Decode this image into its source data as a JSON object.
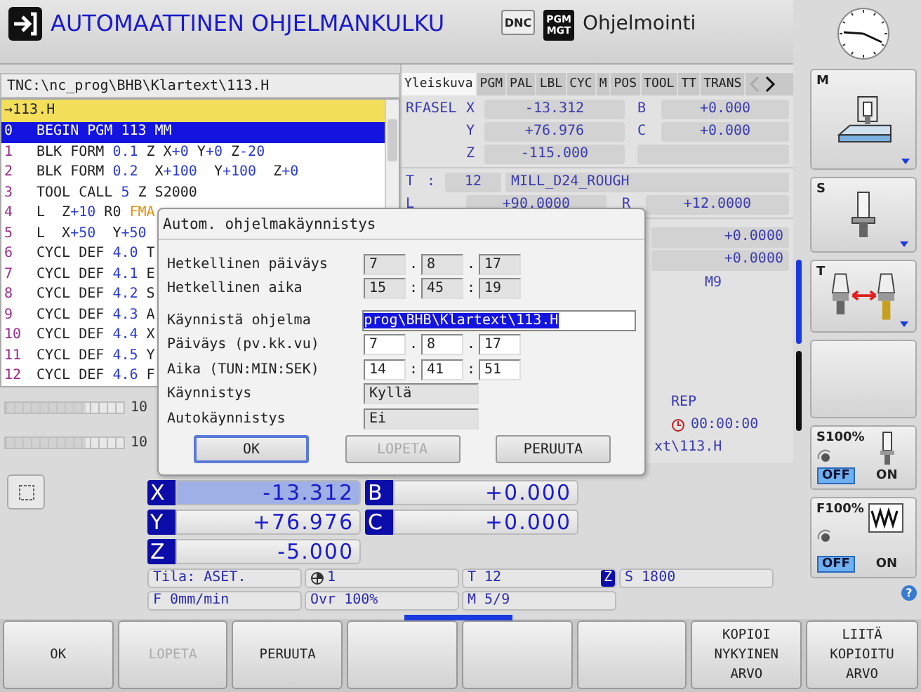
{
  "header": {
    "title": "AUTOMAATTINEN OHJELMANKULKU",
    "badges": [
      {
        "text": "DNC",
        "kind": "light"
      },
      {
        "text": "PGM MGT",
        "kind": "dark"
      }
    ],
    "mode": "Ohjelmointi"
  },
  "program": {
    "path": "TNC:\\nc_prog\\BHB\\Klartext\\113.H",
    "file_arrow": "→",
    "file": "113.H",
    "lines": [
      {
        "number": "0",
        "selected": true,
        "segments": [
          {
            "text": "BEGIN PGM 113 MM",
            "kind": "kw"
          }
        ]
      },
      {
        "number": "1",
        "selected": false,
        "segments": [
          {
            "text": "BLK FORM ",
            "kind": "kw"
          },
          {
            "text": "0.1",
            "kind": "num"
          },
          {
            "text": " Z X",
            "kind": "kw"
          },
          {
            "text": "+0",
            "kind": "num"
          },
          {
            "text": " Y",
            "kind": "kw"
          },
          {
            "text": "+0",
            "kind": "num"
          },
          {
            "text": " Z",
            "kind": "kw"
          },
          {
            "text": "-20",
            "kind": "num"
          }
        ]
      },
      {
        "number": "2",
        "selected": false,
        "segments": [
          {
            "text": "BLK FORM ",
            "kind": "kw"
          },
          {
            "text": "0.2",
            "kind": "num"
          },
          {
            "text": "  X",
            "kind": "kw"
          },
          {
            "text": "+100",
            "kind": "num"
          },
          {
            "text": "  Y",
            "kind": "kw"
          },
          {
            "text": "+100",
            "kind": "num"
          },
          {
            "text": "  Z",
            "kind": "kw"
          },
          {
            "text": "+0",
            "kind": "num"
          }
        ]
      },
      {
        "number": "3",
        "selected": false,
        "segments": [
          {
            "text": "TOOL CALL ",
            "kind": "kw"
          },
          {
            "text": "5",
            "kind": "num"
          },
          {
            "text": " Z S2000",
            "kind": "kw"
          }
        ]
      },
      {
        "number": "4",
        "selected": false,
        "segments": [
          {
            "text": "L  Z",
            "kind": "kw"
          },
          {
            "text": "+10",
            "kind": "num"
          },
          {
            "text": " R0 ",
            "kind": "kw"
          },
          {
            "text": "FMA",
            "kind": "fmax"
          }
        ]
      },
      {
        "number": "5",
        "selected": false,
        "segments": [
          {
            "text": "L  X",
            "kind": "kw"
          },
          {
            "text": "+50",
            "kind": "num"
          },
          {
            "text": "  Y",
            "kind": "kw"
          },
          {
            "text": "+50",
            "kind": "num"
          }
        ]
      },
      {
        "number": "6",
        "selected": false,
        "segments": [
          {
            "text": "CYCL DEF ",
            "kind": "kw"
          },
          {
            "text": "4.0",
            "kind": "num"
          },
          {
            "text": " T",
            "kind": "kw"
          }
        ]
      },
      {
        "number": "7",
        "selected": false,
        "segments": [
          {
            "text": "CYCL DEF ",
            "kind": "kw"
          },
          {
            "text": "4.1",
            "kind": "num"
          },
          {
            "text": " E",
            "kind": "kw"
          }
        ]
      },
      {
        "number": "8",
        "selected": false,
        "segments": [
          {
            "text": "CYCL DEF ",
            "kind": "kw"
          },
          {
            "text": "4.2",
            "kind": "num"
          },
          {
            "text": " S",
            "kind": "kw"
          }
        ]
      },
      {
        "number": "9",
        "selected": false,
        "segments": [
          {
            "text": "CYCL DEF ",
            "kind": "kw"
          },
          {
            "text": "4.3",
            "kind": "num"
          },
          {
            "text": " A",
            "kind": "kw"
          }
        ]
      },
      {
        "number": "10",
        "selected": false,
        "segments": [
          {
            "text": "CYCL DEF ",
            "kind": "kw"
          },
          {
            "text": "4.4",
            "kind": "num"
          },
          {
            "text": " X",
            "kind": "kw"
          }
        ]
      },
      {
        "number": "11",
        "selected": false,
        "segments": [
          {
            "text": "CYCL DEF ",
            "kind": "kw"
          },
          {
            "text": "4.5",
            "kind": "num"
          },
          {
            "text": " Y",
            "kind": "kw"
          }
        ]
      },
      {
        "number": "12",
        "selected": false,
        "segments": [
          {
            "text": "CYCL DEF ",
            "kind": "kw"
          },
          {
            "text": "4.6",
            "kind": "num"
          },
          {
            "text": " F",
            "kind": "kw"
          }
        ]
      }
    ]
  },
  "overrides": [
    {
      "level": 0.68,
      "label": "10"
    },
    {
      "level": 0.68,
      "label": "10"
    }
  ],
  "panel": {
    "tabs": [
      {
        "label": "Yleiskuva",
        "selected": true
      },
      {
        "label": "PGM",
        "selected": false
      },
      {
        "label": "PAL",
        "selected": false
      },
      {
        "label": "LBL",
        "selected": false
      },
      {
        "label": "CYC",
        "selected": false
      },
      {
        "label": "M",
        "selected": false
      },
      {
        "label": "POS",
        "selected": false
      },
      {
        "label": "TOOL",
        "selected": false
      },
      {
        "label": "TT",
        "selected": false
      },
      {
        "label": "TRANS",
        "selected": false
      }
    ],
    "tab_arrows": [
      {
        "kind": "left",
        "disabled": true
      },
      {
        "kind": "right",
        "disabled": false
      }
    ],
    "label": "RFASEL",
    "axes": [
      {
        "axis": "X",
        "value": "-13.312"
      },
      {
        "axis": "Y",
        "value": "+76.976"
      },
      {
        "axis": "Z",
        "value": "-115.000"
      }
    ],
    "rot_axes": [
      {
        "axis": "B",
        "value": "+0.000"
      },
      {
        "axis": "C",
        "value": "+0.000"
      }
    ],
    "tool": {
      "label": "T",
      "separator": ":",
      "number": "12",
      "name": "MILL_D24_ROUGH"
    },
    "dims": [
      {
        "label": "L",
        "value": "+90.0000"
      },
      {
        "label": "R",
        "value": "+12.0000"
      }
    ],
    "more": [
      {
        "kind": "value",
        "text": "+0.0000"
      },
      {
        "kind": "value",
        "text": "+0.0000"
      },
      {
        "kind": "text",
        "text": "M9"
      },
      {
        "kind": "status",
        "text": "REP"
      },
      {
        "kind": "timer",
        "text": "00:00:00"
      },
      {
        "kind": "path",
        "text": "xt\\113.H"
      }
    ]
  },
  "positions": [
    {
      "axis": "X",
      "value": "-13.312",
      "selected": true
    },
    {
      "axis": "B",
      "value": "+0.000",
      "selected": false
    },
    {
      "axis": "Y",
      "value": "+76.976",
      "selected": false
    },
    {
      "axis": "C",
      "value": "+0.000",
      "selected": false
    },
    {
      "axis": "Z",
      "value": "-5.000",
      "selected": false
    }
  ],
  "status": [
    {
      "kind": "text",
      "text": "Tila: ASET."
    },
    {
      "kind": "datum",
      "text": "1"
    },
    {
      "kind": "tool",
      "text": "T 12",
      "axis": "Z"
    },
    {
      "kind": "text",
      "text": "S 1800"
    },
    {
      "kind": "text",
      "text": "F 0mm/min"
    },
    {
      "kind": "text",
      "text": "Ovr 100%"
    },
    {
      "kind": "text",
      "text": "M 5/9"
    }
  ],
  "dialog": {
    "title": "Autom. ohjelmakäynnistys",
    "rows": [
      {
        "label": "Hetkellinen päiväys",
        "kind": "triple",
        "parts": [
          "7",
          "8",
          "17"
        ],
        "separator": ".",
        "editable": false
      },
      {
        "label": "Hetkellinen aika",
        "kind": "triple",
        "parts": [
          "15",
          "45",
          "19"
        ],
        "separator": ":",
        "editable": false
      },
      {
        "label": "Käynnistä ohjelma",
        "kind": "path",
        "value": "prog\\BHB\\Klartext\\113.H",
        "selected": true
      },
      {
        "label": "Päiväys (pv.kk.vu)",
        "kind": "triple",
        "parts": [
          "7",
          "8",
          "17"
        ],
        "separator": ".",
        "editable": true
      },
      {
        "label": "Aika (TUN:MIN:SEK)",
        "kind": "triple",
        "parts": [
          "14",
          "41",
          "51"
        ],
        "separator": ":",
        "editable": true
      },
      {
        "label": "Käynnistys",
        "kind": "value",
        "value": "Kyllä"
      },
      {
        "label": "Autokäynnistys",
        "kind": "value",
        "value": "Ei"
      }
    ],
    "buttons": [
      {
        "label": "OK",
        "focused": true,
        "disabled": false
      },
      {
        "label": "LOPETA",
        "focused": false,
        "disabled": true
      },
      {
        "label": "PERUUTA",
        "focused": false,
        "disabled": false
      }
    ]
  },
  "sidebar": [
    {
      "kind": "machine",
      "label": "M"
    },
    {
      "kind": "spindle",
      "label": "S"
    },
    {
      "kind": "tool_change",
      "label": "T"
    },
    {
      "kind": "empty"
    },
    {
      "kind": "spindle_override",
      "label": "S100%",
      "switch": [
        {
          "text": "OFF",
          "selected": true
        },
        {
          "text": "ON",
          "selected": false
        }
      ]
    },
    {
      "kind": "feed_override",
      "label": "F100%",
      "switch": [
        {
          "text": "OFF",
          "selected": true
        },
        {
          "text": "ON",
          "selected": false
        }
      ]
    }
  ],
  "help": "?",
  "softkeys": [
    {
      "kind": "key",
      "label": "OK",
      "disabled": false
    },
    {
      "kind": "key",
      "label": "LOPETA",
      "disabled": true
    },
    {
      "kind": "key",
      "label": "PERUUTA",
      "disabled": false
    },
    {
      "kind": "empty"
    },
    {
      "kind": "empty"
    },
    {
      "kind": "empty"
    },
    {
      "kind": "key",
      "label": "KOPIOI NYKYINEN ARVO",
      "disabled": false
    },
    {
      "kind": "key",
      "label": "LIITÄ KOPIOITU ARVO",
      "disabled": false
    }
  ]
}
